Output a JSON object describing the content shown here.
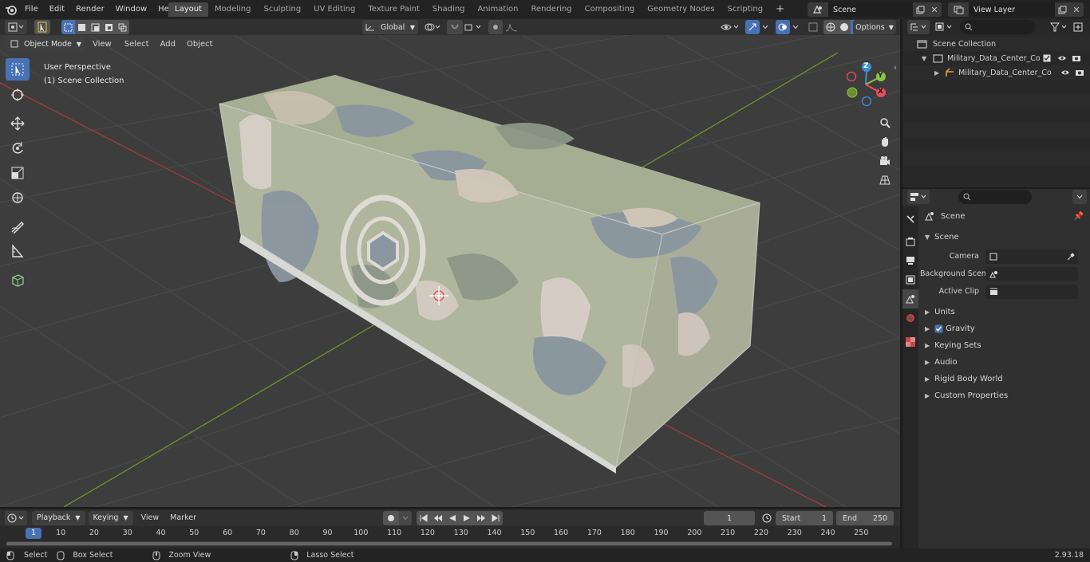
{
  "menu": [
    "File",
    "Edit",
    "Render",
    "Window",
    "Help"
  ],
  "workspace_tabs": [
    "Layout",
    "Modeling",
    "Sculpting",
    "UV Editing",
    "Texture Paint",
    "Shading",
    "Animation",
    "Rendering",
    "Compositing",
    "Geometry Nodes",
    "Scripting"
  ],
  "active_tab": "Layout",
  "scene_name": "Scene",
  "view_layer": "View Layer",
  "viewport": {
    "mode": "Object Mode",
    "menus": [
      "View",
      "Select",
      "Add",
      "Object"
    ],
    "transform_orientation": "Global",
    "options_label": "Options",
    "perspective_label": "User Perspective",
    "collection_label": "(1) Scene Collection",
    "gizmo_axes": {
      "z": "Z",
      "y": "Y",
      "x": "X"
    }
  },
  "outliner": {
    "root": "Scene Collection",
    "collection": "Military_Data_Center_Contair",
    "object": "Military_Data_Center_Co"
  },
  "properties": {
    "title": "Scene",
    "section": "Scene",
    "fields": [
      {
        "label": "Camera",
        "value": ""
      },
      {
        "label": "Background Scene",
        "value": ""
      },
      {
        "label": "Active Clip",
        "value": ""
      }
    ],
    "panels": [
      "Units",
      "Gravity",
      "Keying Sets",
      "Audio",
      "Rigid Body World",
      "Custom Properties"
    ],
    "gravity_checked": true
  },
  "timeline": {
    "menus": [
      "Playback",
      "Keying",
      "View",
      "Marker"
    ],
    "current_frame": "1",
    "start_label": "Start",
    "start": "1",
    "end_label": "End",
    "end": "250",
    "ticks": [
      "1",
      "10",
      "20",
      "30",
      "40",
      "50",
      "60",
      "70",
      "80",
      "90",
      "100",
      "110",
      "120",
      "130",
      "140",
      "150",
      "160",
      "170",
      "180",
      "190",
      "200",
      "210",
      "220",
      "230",
      "240",
      "250"
    ]
  },
  "status": {
    "items": [
      "Select",
      "Box Select",
      "Zoom View",
      "Lasso Select"
    ],
    "version": "2.93.18"
  },
  "colors": {
    "accent": "#4772b3",
    "axis_x": "#e84e5b",
    "axis_y": "#8bc53f",
    "axis_z": "#3d8fd9"
  }
}
